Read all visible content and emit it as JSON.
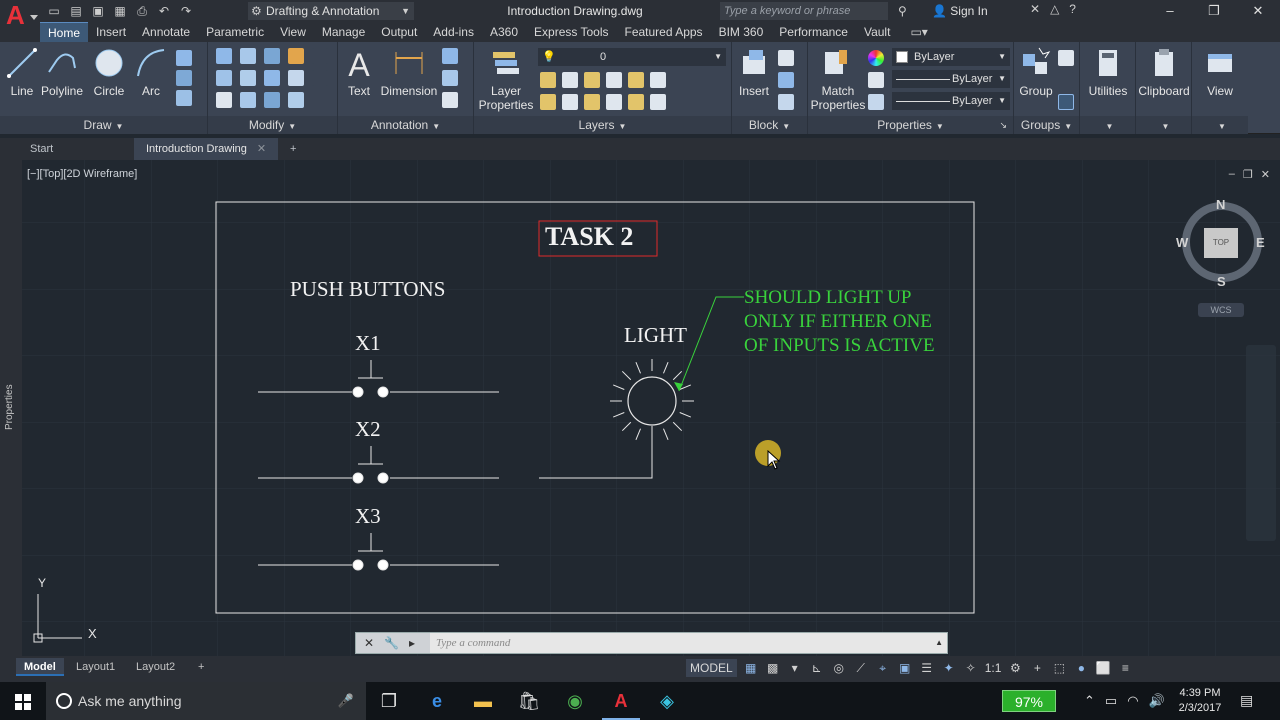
{
  "titlebar": {
    "app_logo": "A",
    "workspace": "Drafting & Annotation",
    "document_title": "Introduction Drawing.dwg",
    "search_placeholder": "Type a keyword or phrase",
    "sign_in": "Sign In"
  },
  "ribbon_tabs": [
    "Home",
    "Insert",
    "Annotate",
    "Parametric",
    "View",
    "Manage",
    "Output",
    "Add-ins",
    "A360",
    "Express Tools",
    "Featured Apps",
    "BIM 360",
    "Performance",
    "Vault"
  ],
  "ribbon": {
    "draw": {
      "label": "Draw",
      "tools": [
        "Line",
        "Polyline",
        "Circle",
        "Arc"
      ]
    },
    "modify": {
      "label": "Modify"
    },
    "annotation": {
      "label": "Annotation",
      "tools": [
        "Text",
        "Dimension"
      ]
    },
    "layers": {
      "label": "Layers",
      "tool": "Layer",
      "tool2": "Properties",
      "current_layer": "0"
    },
    "block": {
      "label": "Block",
      "tool": "Insert"
    },
    "properties": {
      "label": "Properties",
      "tool": "Match",
      "tool2": "Properties",
      "color": "ByLayer",
      "linetype": "ByLayer",
      "lineweight": "ByLayer"
    },
    "groups": {
      "label": "Groups",
      "tool": "Group"
    },
    "utilities": {
      "label": "Utilities"
    },
    "clipboard": {
      "label": "Clipboard"
    },
    "view": {
      "label": "View"
    }
  },
  "file_tabs": {
    "start": "Start",
    "current": "Introduction Drawing"
  },
  "viewport": {
    "label": "[−][Top][2D Wireframe]"
  },
  "side_palette": {
    "label": "Properties"
  },
  "drawing": {
    "title": "TASK 2",
    "push_buttons_label": "PUSH BUTTONS",
    "inputs": [
      "X1",
      "X2",
      "X3"
    ],
    "light_label": "LIGHT",
    "note_lines": [
      "SHOULD LIGHT UP",
      "ONLY IF EITHER ONE",
      "OF INPUTS IS ACTIVE"
    ]
  },
  "viewcube": {
    "n": "N",
    "s": "S",
    "e": "E",
    "w": "W",
    "top": "TOP",
    "wcs": "WCS"
  },
  "ucs": {
    "x": "X",
    "y": "Y"
  },
  "command_line": {
    "placeholder": "Type a command"
  },
  "layout_tabs": [
    "Model",
    "Layout1",
    "Layout2"
  ],
  "status_bar": {
    "model": "MODEL",
    "scale": "1:1"
  },
  "taskbar": {
    "search": "Ask me anything",
    "battery": "97%",
    "time": "4:39 PM",
    "date": "2/3/2017"
  },
  "colors": {
    "canvas_bg": "#212830",
    "ribbon_bg": "#3b4453",
    "accent": "#3d5977",
    "note_green": "#39d23c",
    "title_box_red": "#e02a2a",
    "battery_green": "#2bb02b"
  }
}
